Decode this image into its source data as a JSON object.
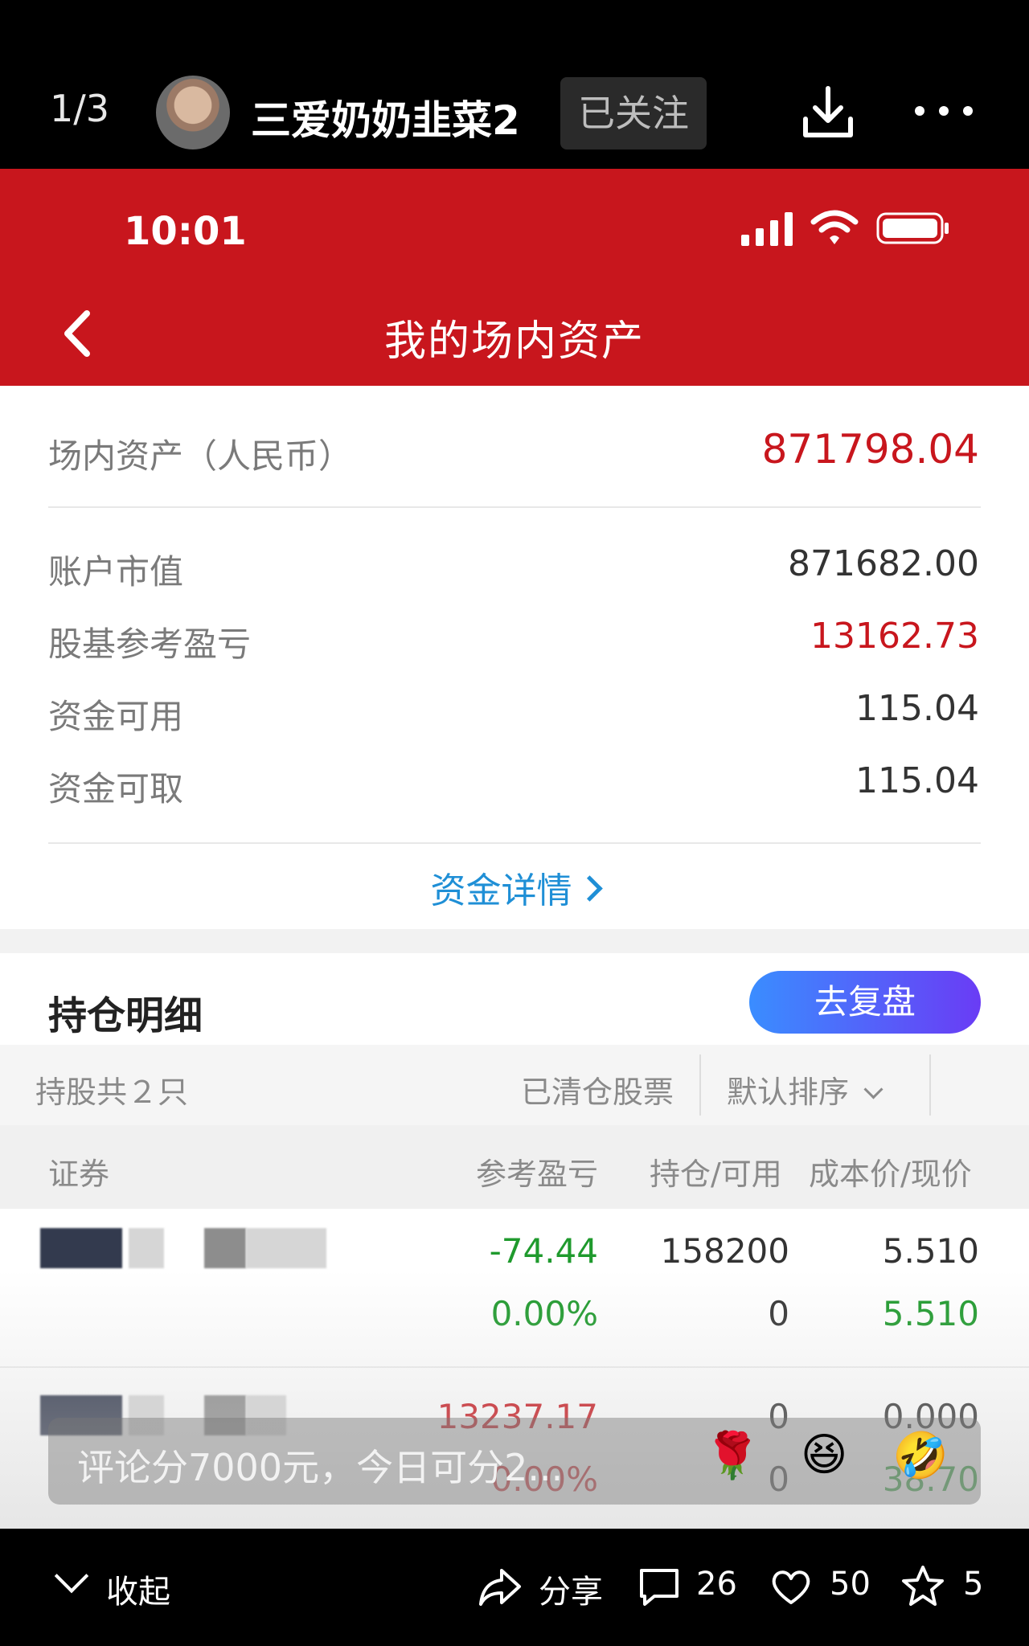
{
  "viewer": {
    "page_counter": "1/3",
    "author_name": "三爱奶奶韭菜2",
    "follow_label": "已关注"
  },
  "status_bar": {
    "time": "10:01"
  },
  "page": {
    "title": "我的场内资产"
  },
  "assets": {
    "total_label": "场内资产（人民币）",
    "total_value": "871798.04",
    "rows": [
      {
        "label": "账户市值",
        "value": "871682.00"
      },
      {
        "label": "股基参考盈亏",
        "value": "13162.73"
      },
      {
        "label": "资金可用",
        "value": "115.04"
      },
      {
        "label": "资金可取",
        "value": "115.04"
      }
    ],
    "detail_link": "资金详情"
  },
  "holdings": {
    "title": "持仓明细",
    "review_button": "去复盘",
    "count_label": "持股共２只",
    "cleared_label": "已清仓股票",
    "sort_label": "默认排序",
    "columns": [
      "证券",
      "参考盈亏",
      "持仓/可用",
      "成本价/现价"
    ],
    "rows": [
      {
        "pl": "-74.44",
        "pl_pct": "0.00%",
        "position": "158200",
        "available": "0",
        "cost": "5.510",
        "price": "5.510"
      },
      {
        "pl": "13237.17",
        "pl_pct": "0.00%",
        "position": "0",
        "available": "0",
        "cost": "0.000",
        "price": "38.70"
      }
    ]
  },
  "comment_overlay": {
    "text": "评论分7000元，今日可分2..."
  },
  "bottom_bar": {
    "collapse": "收起",
    "share": "分享",
    "comments": "26",
    "likes": "50",
    "favorites": "5"
  },
  "colors": {
    "brand_red": "#c8161d",
    "gain_red": "#c8161d",
    "loss_green": "#1f9a2d",
    "link_blue": "#1f8fd6"
  }
}
